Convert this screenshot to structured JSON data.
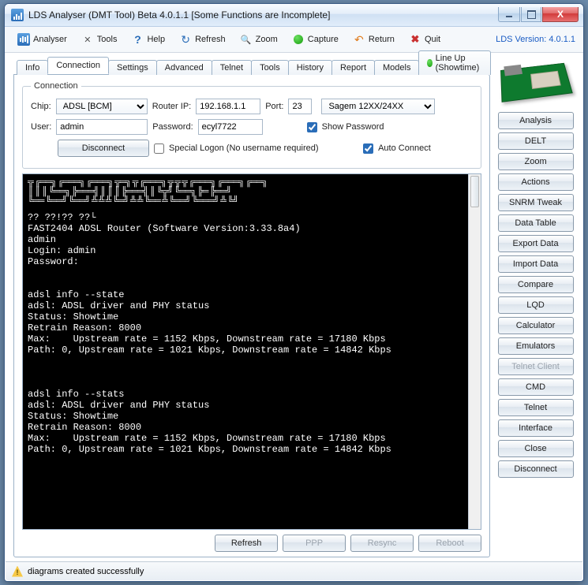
{
  "window": {
    "title": "LDS Analyser (DMT Tool) Beta 4.0.1.1 [Some Functions are Incomplete]"
  },
  "toolbar": {
    "analyser": "Analyser",
    "tools": "Tools",
    "help": "Help",
    "refresh": "Refresh",
    "zoom": "Zoom",
    "capture": "Capture",
    "return": "Return",
    "quit": "Quit",
    "version": "LDS Version: 4.0.1.1"
  },
  "tabs": {
    "info": "Info",
    "connection": "Connection",
    "settings": "Settings",
    "advanced": "Advanced",
    "telnet": "Telnet",
    "tools": "Tools",
    "history": "History",
    "report": "Report",
    "models": "Models",
    "lineup": "Line Up (Showtime)"
  },
  "conn": {
    "legend": "Connection",
    "chip_lbl": "Chip:",
    "chip_val": "ADSL [BCM]",
    "routerip_lbl": "Router IP:",
    "routerip_val": "192.168.1.1",
    "port_lbl": "Port:",
    "port_val": "23",
    "model_val": "Sagem 12XX/24XX",
    "user_lbl": "User:",
    "user_val": "admin",
    "password_lbl": "Password:",
    "password_val": "ecyl7722",
    "showpw": "Show Password",
    "disconnect": "Disconnect",
    "special": "Special Logon (No username required)",
    "autoconn": "Auto Connect"
  },
  "terminal": "?? ??!?? ??└\nFAST2404 ADSL Router (Software Version:3.33.8a4)\nadmin\nLogin: admin\nPassword:\n\n\nadsl info --state\nadsl: ADSL driver and PHY status\nStatus: Showtime\nRetrain Reason: 8000\nMax:    Upstream rate = 1152 Kbps, Downstream rate = 17180 Kbps\nPath: 0, Upstream rate = 1021 Kbps, Downstream rate = 14842 Kbps\n\n\n\nadsl info --stats\nadsl: ADSL driver and PHY status\nStatus: Showtime\nRetrain Reason: 8000\nMax:    Upstream rate = 1152 Kbps, Downstream rate = 17180 Kbps\nPath: 0, Upstream rate = 1021 Kbps, Downstream rate = 14842 Kbps",
  "bottom": {
    "refresh": "Refresh",
    "ppp": "PPP",
    "resync": "Resync",
    "reboot": "Reboot"
  },
  "side": {
    "analysis": "Analysis",
    "delt": "DELT",
    "zoom": "Zoom",
    "actions": "Actions",
    "snrm": "SNRM Tweak",
    "datatable": "Data Table",
    "export": "Export Data",
    "import": "Import Data",
    "compare": "Compare",
    "lqd": "LQD",
    "calc": "Calculator",
    "emulators": "Emulators",
    "telnetclient": "Telnet Client",
    "cmd": "CMD",
    "telnet": "Telnet",
    "interface": "Interface",
    "close": "Close",
    "disconnect": "Disconnect"
  },
  "status": "diagrams created successfully"
}
